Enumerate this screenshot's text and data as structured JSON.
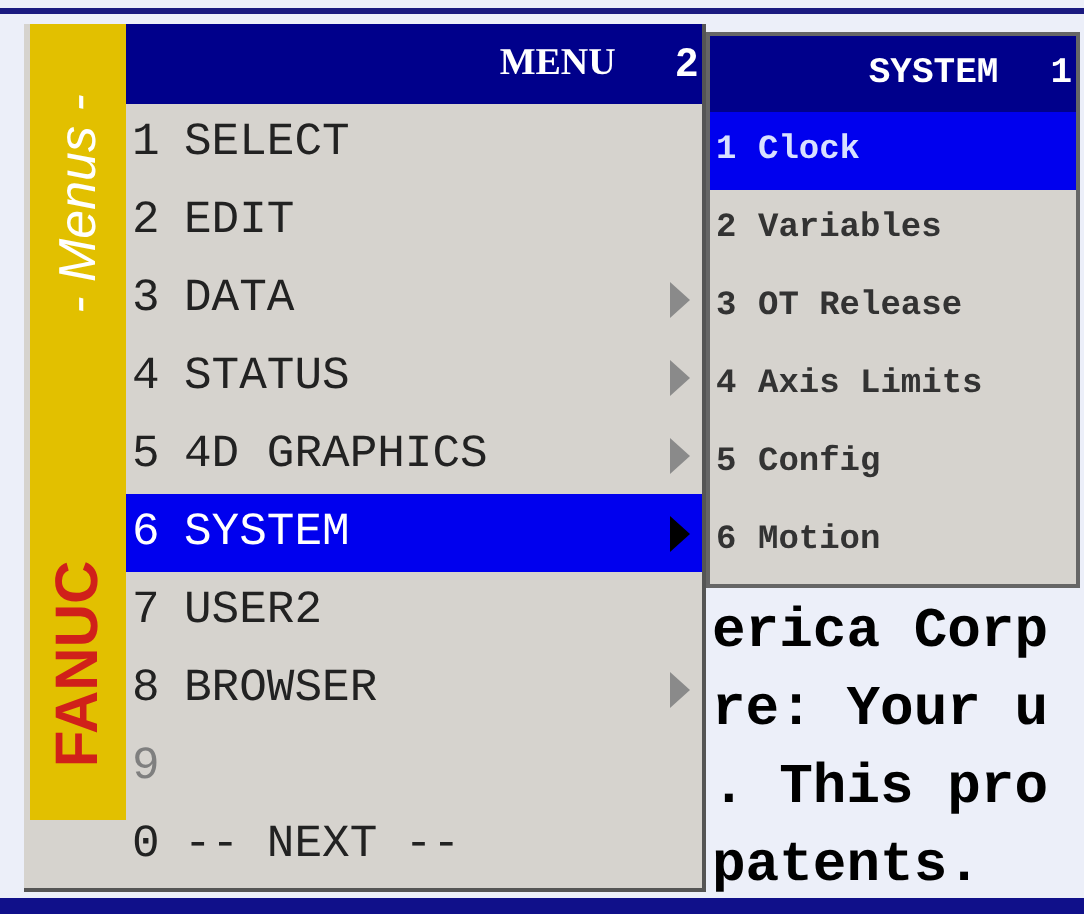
{
  "background_text": {
    "lines": [
      "erica Corp",
      "re: Your u",
      ". This pro",
      "patents."
    ]
  },
  "side_strip": {
    "title": "- Menus -",
    "brand": "FANUC"
  },
  "menu": {
    "title": "MENU",
    "page": "2",
    "items": [
      {
        "number": "1",
        "label": "SELECT",
        "has_submenu": false,
        "selected": false,
        "disabled": false
      },
      {
        "number": "2",
        "label": "EDIT",
        "has_submenu": false,
        "selected": false,
        "disabled": false
      },
      {
        "number": "3",
        "label": "DATA",
        "has_submenu": true,
        "selected": false,
        "disabled": false
      },
      {
        "number": "4",
        "label": "STATUS",
        "has_submenu": true,
        "selected": false,
        "disabled": false
      },
      {
        "number": "5",
        "label": "4D GRAPHICS",
        "has_submenu": true,
        "selected": false,
        "disabled": false
      },
      {
        "number": "6",
        "label": "SYSTEM",
        "has_submenu": true,
        "selected": true,
        "disabled": false
      },
      {
        "number": "7",
        "label": "USER2",
        "has_submenu": false,
        "selected": false,
        "disabled": false
      },
      {
        "number": "8",
        "label": "BROWSER",
        "has_submenu": true,
        "selected": false,
        "disabled": false
      },
      {
        "number": "9",
        "has_submenu": false,
        "selected": false,
        "disabled": true
      },
      {
        "number": "0",
        "label": "-- NEXT --",
        "has_submenu": false,
        "selected": false,
        "disabled": false
      }
    ]
  },
  "submenu": {
    "title": "SYSTEM",
    "page": "1",
    "items": [
      {
        "number": "1",
        "label": "Clock",
        "selected": true
      },
      {
        "number": "2",
        "label": "Variables",
        "selected": false
      },
      {
        "number": "3",
        "label": "OT Release",
        "selected": false
      },
      {
        "number": "4",
        "label": "Axis Limits",
        "selected": false
      },
      {
        "number": "5",
        "label": "Config",
        "selected": false
      },
      {
        "number": "6",
        "label": "Motion",
        "selected": false
      }
    ]
  }
}
